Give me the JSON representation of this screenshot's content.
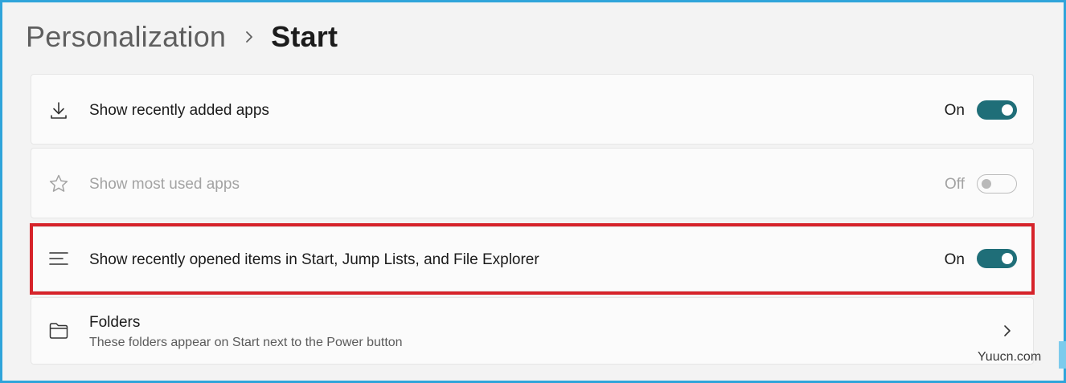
{
  "breadcrumb": {
    "parent": "Personalization",
    "current": "Start"
  },
  "settings": [
    {
      "label": "Show recently added apps",
      "state": "On",
      "enabled": true,
      "icon": "download-icon"
    },
    {
      "label": "Show most used apps",
      "state": "Off",
      "enabled": false,
      "icon": "star-icon"
    },
    {
      "label": "Show recently opened items in Start, Jump Lists, and File Explorer",
      "state": "On",
      "enabled": true,
      "icon": "list-icon",
      "highlighted": true
    }
  ],
  "folders": {
    "title": "Folders",
    "description": "These folders appear on Start next to the Power button",
    "icon": "folder-icon"
  },
  "watermark": "Yuucn.com",
  "colors": {
    "toggle_on": "#1f6e78",
    "highlight": "#d6232a",
    "frame": "#2fa4da"
  }
}
